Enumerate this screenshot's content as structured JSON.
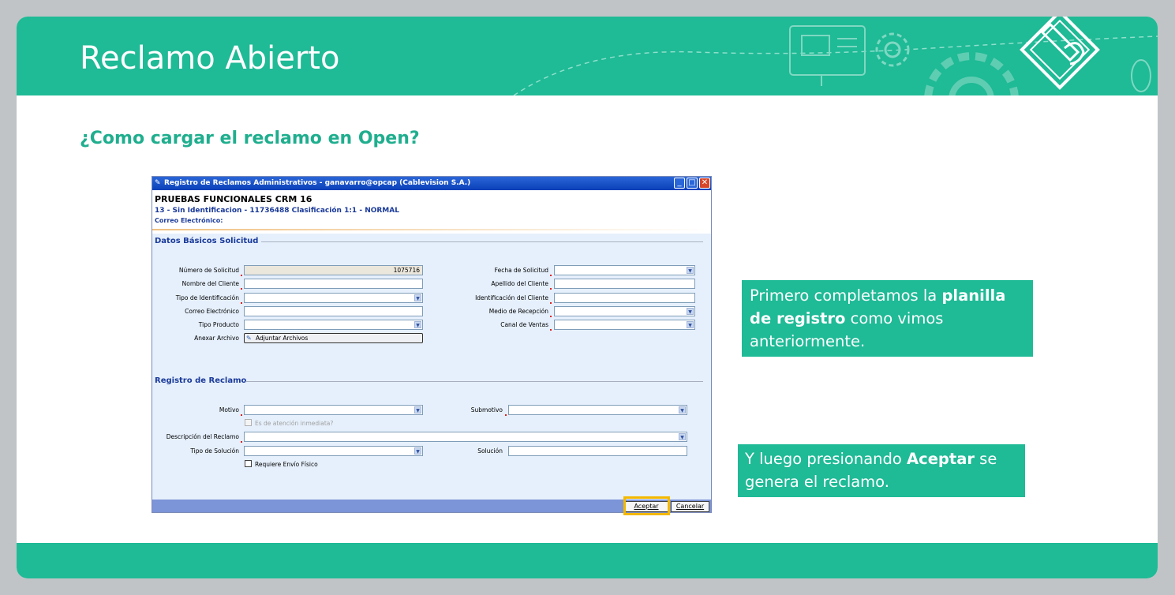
{
  "slide": {
    "title": "Reclamo Abierto",
    "subtitle": "¿Como cargar el reclamo en Open?",
    "accent_color": "#1fba96"
  },
  "window": {
    "title": "Registro de Reclamos Administrativos - ganavarro@opcap (Cablevision S.A.)",
    "minimize": "_",
    "maximize": "□",
    "close": "✕",
    "header": {
      "name": "PRUEBAS FUNCIONALES  CRM 16",
      "line": "13 - Sin Identificacion - 11736488 Clasificación 1:1 - NORMAL",
      "email": "Correo Electrónico:"
    },
    "basic": {
      "section": "Datos Básicos Solicitud",
      "numero_solicitud_label": "Número de Solicitud",
      "numero_solicitud_value": "1075716",
      "nombre_cliente_label": "Nombre del Cliente",
      "tipo_identificacion_label": "Tipo de Identificación",
      "correo_label": "Correo Electrónico",
      "tipo_producto_label": "Tipo Producto",
      "anexar_label": "Anexar Archivo",
      "adjuntar_button": "Adjuntar Archivos",
      "fecha_solicitud_label": "Fecha de Solicitud",
      "apellido_label": "Apellido del Cliente",
      "identificacion_label": "Identificación del Cliente",
      "medio_recepcion_label": "Medio de Recepción",
      "canal_ventas_label": "Canal de Ventas"
    },
    "claim": {
      "section": "Registro de Reclamo",
      "motivo_label": "Motivo",
      "submotivo_label": "Submotivo",
      "atencion_inmediata_label": "Es de atención inmediata?",
      "descripcion_label": "Descripción del Reclamo",
      "tipo_solucion_label": "Tipo de Solución",
      "solucion_label": "Solución",
      "requiere_envio_label": "Requiere Envío Físico"
    },
    "buttons": {
      "accept": "Aceptar",
      "cancel": "Cancelar"
    }
  },
  "callouts": {
    "first": {
      "part1": "Primero completamos la ",
      "bold": "planilla de registro",
      "part2": " como vimos anteriormente."
    },
    "second": {
      "part1": "Y luego presionando ",
      "bold": "Aceptar",
      "part2": "  se genera el reclamo."
    }
  }
}
